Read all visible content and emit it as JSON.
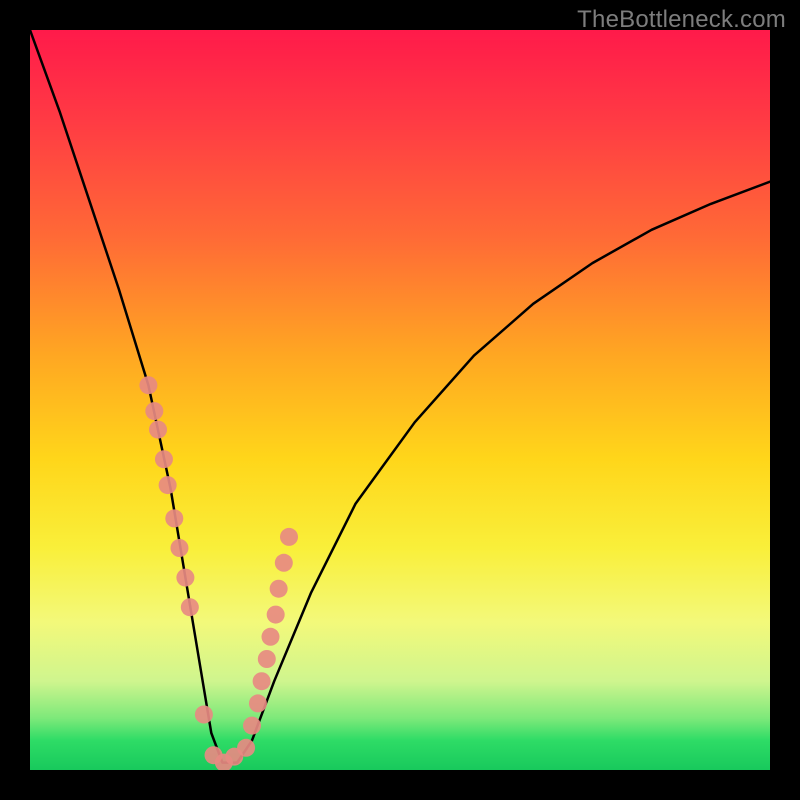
{
  "watermark": "TheBottleneck.com",
  "chart_data": {
    "type": "line",
    "title": "",
    "xlabel": "",
    "ylabel": "",
    "xlim": [
      0,
      100
    ],
    "ylim": [
      0,
      100
    ],
    "grid": false,
    "series": [
      {
        "name": "bottleneck-curve",
        "x": [
          0,
          4,
          8,
          12,
          16,
          19,
          21,
          23,
          24.5,
          26,
          28,
          30,
          33,
          38,
          44,
          52,
          60,
          68,
          76,
          84,
          92,
          100
        ],
        "y": [
          100,
          89,
          77,
          65,
          52,
          38,
          26,
          14,
          5,
          1,
          1,
          4,
          12,
          24,
          36,
          47,
          56,
          63,
          68.5,
          73,
          76.5,
          79.5
        ]
      }
    ],
    "dots": {
      "name": "marked-points",
      "color": "#e78a82",
      "radius_px": 9,
      "x": [
        16.0,
        16.8,
        17.3,
        18.1,
        18.6,
        19.5,
        20.2,
        21.0,
        21.6,
        23.5,
        24.8,
        26.2,
        27.6,
        29.2,
        30.0,
        30.8,
        31.3,
        32.0,
        32.5,
        33.2,
        33.6,
        34.3,
        35.0
      ],
      "y": [
        52.0,
        48.5,
        46.0,
        42.0,
        38.5,
        34.0,
        30.0,
        26.0,
        22.0,
        7.5,
        2.0,
        1.0,
        1.8,
        3.0,
        6.0,
        9.0,
        12.0,
        15.0,
        18.0,
        21.0,
        24.5,
        28.0,
        31.5
      ]
    },
    "background_gradient": {
      "top": "#ff1a4a",
      "upper_mid": "#ffa722",
      "mid": "#f9ef3a",
      "lower_mid": "#cff58e",
      "bottom": "#18c95c"
    }
  }
}
